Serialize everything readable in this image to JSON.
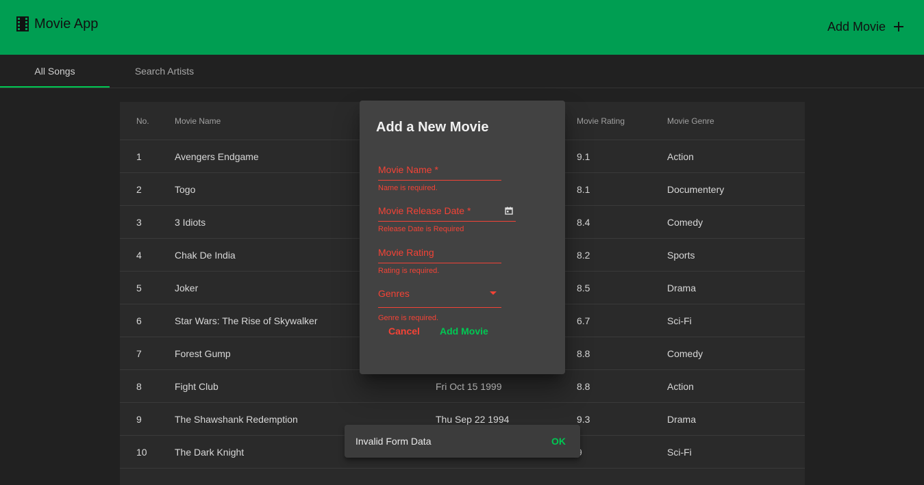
{
  "app": {
    "title": "Movie App",
    "add_movie_label": "Add Movie"
  },
  "tabs": [
    {
      "label": "All Songs"
    },
    {
      "label": "Search Artists"
    }
  ],
  "table": {
    "headers": {
      "no": "No.",
      "name": "Movie Name",
      "rating": "Movie Rating",
      "genre": "Movie Genre"
    },
    "rows": [
      {
        "no": "1",
        "name": "Avengers Endgame",
        "date": "",
        "rating": "9.1",
        "genre": "Action"
      },
      {
        "no": "2",
        "name": "Togo",
        "date": "",
        "rating": "8.1",
        "genre": "Documentery"
      },
      {
        "no": "3",
        "name": "3 Idiots",
        "date": "",
        "rating": "8.4",
        "genre": "Comedy"
      },
      {
        "no": "4",
        "name": "Chak De India",
        "date": "",
        "rating": "8.2",
        "genre": "Sports"
      },
      {
        "no": "5",
        "name": "Joker",
        "date": "",
        "rating": "8.5",
        "genre": "Drama"
      },
      {
        "no": "6",
        "name": "Star Wars: The Rise of Skywalker",
        "date": "",
        "rating": "6.7",
        "genre": "Sci-Fi"
      },
      {
        "no": "7",
        "name": "Forest Gump",
        "date": "",
        "rating": "8.8",
        "genre": "Comedy"
      },
      {
        "no": "8",
        "name": "Fight Club",
        "date": "Fri Oct 15 1999",
        "rating": "8.8",
        "genre": "Action"
      },
      {
        "no": "9",
        "name": "The Shawshank Redemption",
        "date": "Thu Sep 22 1994",
        "rating": "9.3",
        "genre": "Drama"
      },
      {
        "no": "10",
        "name": "The Dark Knight",
        "date": "",
        "rating": "9",
        "genre": "Sci-Fi"
      }
    ]
  },
  "dialog": {
    "title": "Add a New Movie",
    "fields": {
      "name": {
        "label": "Movie Name *",
        "error": "Name is required."
      },
      "date": {
        "label": "Movie Release Date *",
        "error": "Release Date is Required"
      },
      "rating": {
        "label": "Movie Rating",
        "error": "Rating is required."
      },
      "genres": {
        "label": "Genres",
        "error": "Genre is required."
      }
    },
    "cancel_label": "Cancel",
    "submit_label": "Add Movie"
  },
  "snackbar": {
    "message": "Invalid Form Data",
    "action": "OK"
  },
  "colors": {
    "primary": "#009e52",
    "accent": "#00c853",
    "error": "#f44336",
    "background": "#212121"
  },
  "icons": {
    "brand": "film-icon",
    "add": "plus-icon",
    "date": "calendar-icon",
    "select": "dropdown-arrow-icon"
  }
}
